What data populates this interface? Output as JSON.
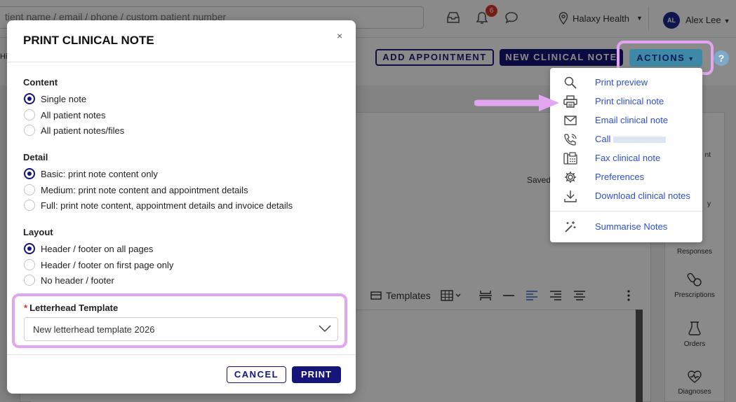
{
  "topbar": {
    "search_placeholder": "tient name / email / phone / custom patient number",
    "notifications_count": "6",
    "location": "Halaxy Health",
    "user_initials": "AL",
    "user_name": "Alex Lee"
  },
  "page": {
    "header_cut": "Hi",
    "add_appointment": "ADD APPOINTMENT",
    "new_clinical_note": "NEW CLINICAL NOTE",
    "actions": "ACTIONS",
    "help": "?",
    "saved_text": "Saved",
    "toolbar_templates": "Templates",
    "right_col": {
      "cut_label_1": "nt",
      "cut_label_2": "y",
      "responses": "Responses",
      "prescriptions": "Prescriptions",
      "orders": "Orders",
      "diagnoses": "Diagnoses"
    }
  },
  "actions_menu": {
    "items": [
      {
        "label": "Print preview",
        "icon": "search-icon"
      },
      {
        "label": "Print clinical note",
        "icon": "printer-icon"
      },
      {
        "label": "Email clinical note",
        "icon": "envelope-icon"
      },
      {
        "label": "Call",
        "icon": "phone-icon"
      },
      {
        "label": "Fax clinical note",
        "icon": "fax-icon"
      },
      {
        "label": "Preferences",
        "icon": "gear-icon"
      },
      {
        "label": "Download clinical notes",
        "icon": "download-icon"
      },
      {
        "label": "Summarise Notes",
        "icon": "magic-wand-icon"
      }
    ]
  },
  "modal": {
    "title": "PRINT CLINICAL NOTE",
    "close": "×",
    "content": {
      "label": "Content",
      "options": [
        "Single note",
        "All patient notes",
        "All patient notes/files"
      ],
      "selected": "Single note"
    },
    "detail": {
      "label": "Detail",
      "options": [
        "Basic: print note content only",
        "Medium: print note content and appointment details",
        "Full: print note content, appointment details and invoice details"
      ],
      "selected": "Basic: print note content only"
    },
    "layout": {
      "label": "Layout",
      "options": [
        "Header / footer on all pages",
        "Header / footer on first page only",
        "No header / footer"
      ],
      "selected": "Header / footer on all pages"
    },
    "letterhead": {
      "required_mark": "*",
      "label": "Letterhead Template",
      "value": "New letterhead template 2026"
    },
    "cancel": "CANCEL",
    "print": "PRINT"
  },
  "colors": {
    "primary": "#15157a",
    "link": "#2d4fd0",
    "highlight": "#e2a6f0",
    "badge": "#d9362b"
  }
}
